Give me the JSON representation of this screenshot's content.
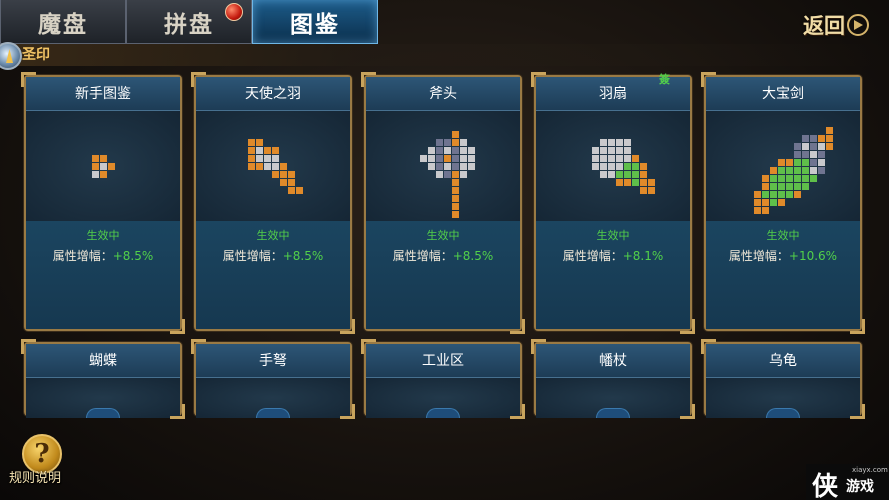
{
  "tabs": [
    {
      "label": "魔盘",
      "active": false
    },
    {
      "label": "拼盘",
      "active": false,
      "badge": true
    },
    {
      "label": "图鉴",
      "active": true
    }
  ],
  "back_label": "返回",
  "section_title": "圣印",
  "new_mark": "簽",
  "cards": [
    {
      "title": "新手图鉴",
      "status": "生效中",
      "attr_label": "属性增幅：",
      "attr_value": "+8.5%",
      "icon": "pixel-dot-icon"
    },
    {
      "title": "天使之羽",
      "status": "生效中",
      "attr_label": "属性增幅：",
      "attr_value": "+8.5%",
      "icon": "pixel-wing-icon"
    },
    {
      "title": "斧头",
      "status": "生效中",
      "attr_label": "属性增幅：",
      "attr_value": "+8.5%",
      "icon": "pixel-axe-icon"
    },
    {
      "title": "羽扇",
      "status": "生效中",
      "attr_label": "属性增幅：",
      "attr_value": "+8.1%",
      "icon": "pixel-fan-icon"
    },
    {
      "title": "大宝剑",
      "status": "生效中",
      "attr_label": "属性增幅：",
      "attr_value": "+10.6%",
      "icon": "pixel-sword-icon"
    }
  ],
  "cards_row2": [
    {
      "title": "蝴蝶"
    },
    {
      "title": "手弩"
    },
    {
      "title": "工业区"
    },
    {
      "title": "幡杖"
    },
    {
      "title": "乌龟"
    }
  ],
  "rules_label": "规则说明",
  "rules_icon": "?",
  "watermark": {
    "big": "侠",
    "small": "游戏",
    "url": "xiayx.com"
  },
  "colors": {
    "accent_green": "#52d04a",
    "card_frame": "#9a7a44",
    "tab_active": "#1d5c8a",
    "pixel_orange": "#e08a2a",
    "pixel_gray": "#c9c9cc",
    "pixel_green": "#5fbf4a",
    "pixel_slate": "#6f7490"
  }
}
